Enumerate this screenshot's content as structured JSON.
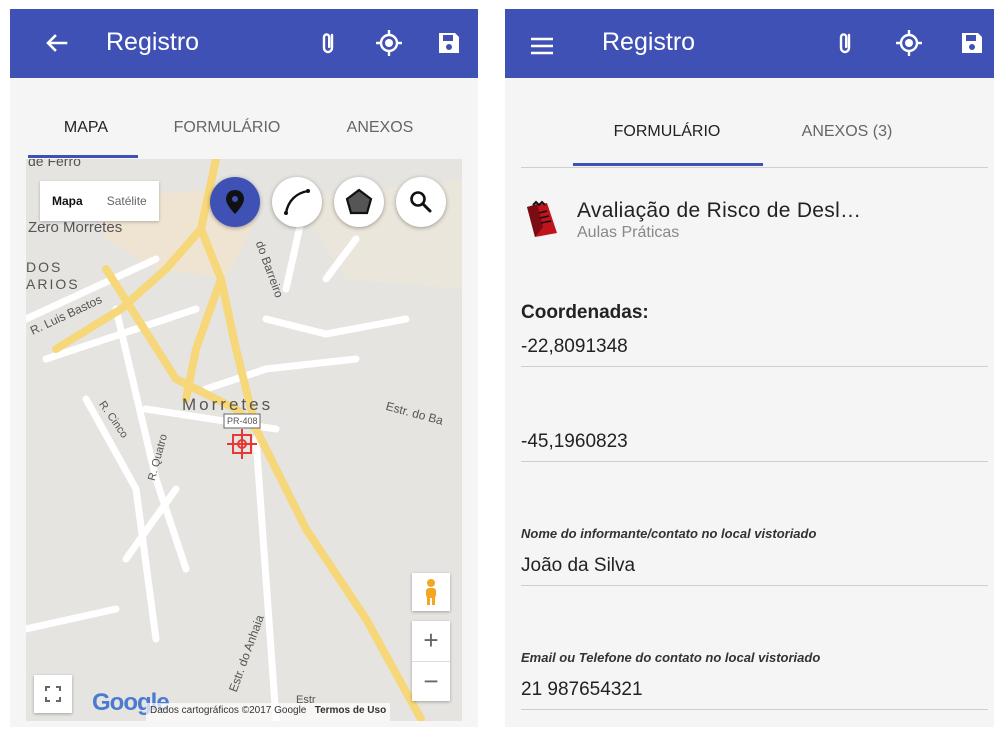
{
  "left_screen": {
    "appbar": {
      "title": "Registro",
      "nav_icon": "arrow-back-icon",
      "actions": [
        "paperclip-icon",
        "gps-locate-icon",
        "save-disk-icon"
      ]
    },
    "tabs": [
      {
        "label": "MAPA",
        "active": true
      },
      {
        "label": "FORMULÁRIO",
        "active": false
      },
      {
        "label": "ANEXOS",
        "active": false
      }
    ],
    "map": {
      "map_type": {
        "map": "Mapa",
        "satellite": "Satélite"
      },
      "tools": [
        "map-marker-icon",
        "polyline-icon",
        "polygon-icon",
        "search-icon"
      ],
      "labels": {
        "l1": "de Ferro",
        "l2": "Zero Morretes",
        "l3": "DOS",
        "l4": "ARIOS",
        "l5": "R. Luis Bastos",
        "l6": "do Barreiro",
        "l7": "Morretes",
        "l8": "PR-408",
        "l9": "Estr. do Ba",
        "l10": "R. Cinco",
        "l11": "R. Quatro",
        "l12": "Estr. do Anhaia",
        "l13": "Estr"
      },
      "zoom_in": "+",
      "zoom_out": "−",
      "google_logo": "Google",
      "attribution": "Dados cartográficos ©2017 Google",
      "terms": "Termos de Uso"
    }
  },
  "right_screen": {
    "appbar": {
      "title": "Registro",
      "nav_icon": "menu-hamburger-icon",
      "actions": [
        "paperclip-icon",
        "gps-locate-icon",
        "save-disk-icon"
      ]
    },
    "tabs": [
      {
        "label": "FORMULÁRIO",
        "active": true
      },
      {
        "label": "ANEXOS (3)",
        "active": false
      }
    ],
    "form": {
      "icon": "form-document-icon",
      "title": "Avaliação de Risco de Desl…",
      "subtitle": "Aulas Práticas",
      "coordinates_label": "Coordenadas:",
      "latitude": "-22,8091348",
      "longitude": "-45,1960823",
      "field1_label": "Nome do informante/contato no local vistoriado",
      "field1_value": "João da Silva",
      "field2_label": "Email ou Telefone do contato no local vistoriado",
      "field2_value": "21 987654321"
    }
  },
  "colors": {
    "primary": "#3f51b5",
    "road": "#f6d77a",
    "map_bg": "#e6e4e0",
    "marker": "#e53935"
  }
}
